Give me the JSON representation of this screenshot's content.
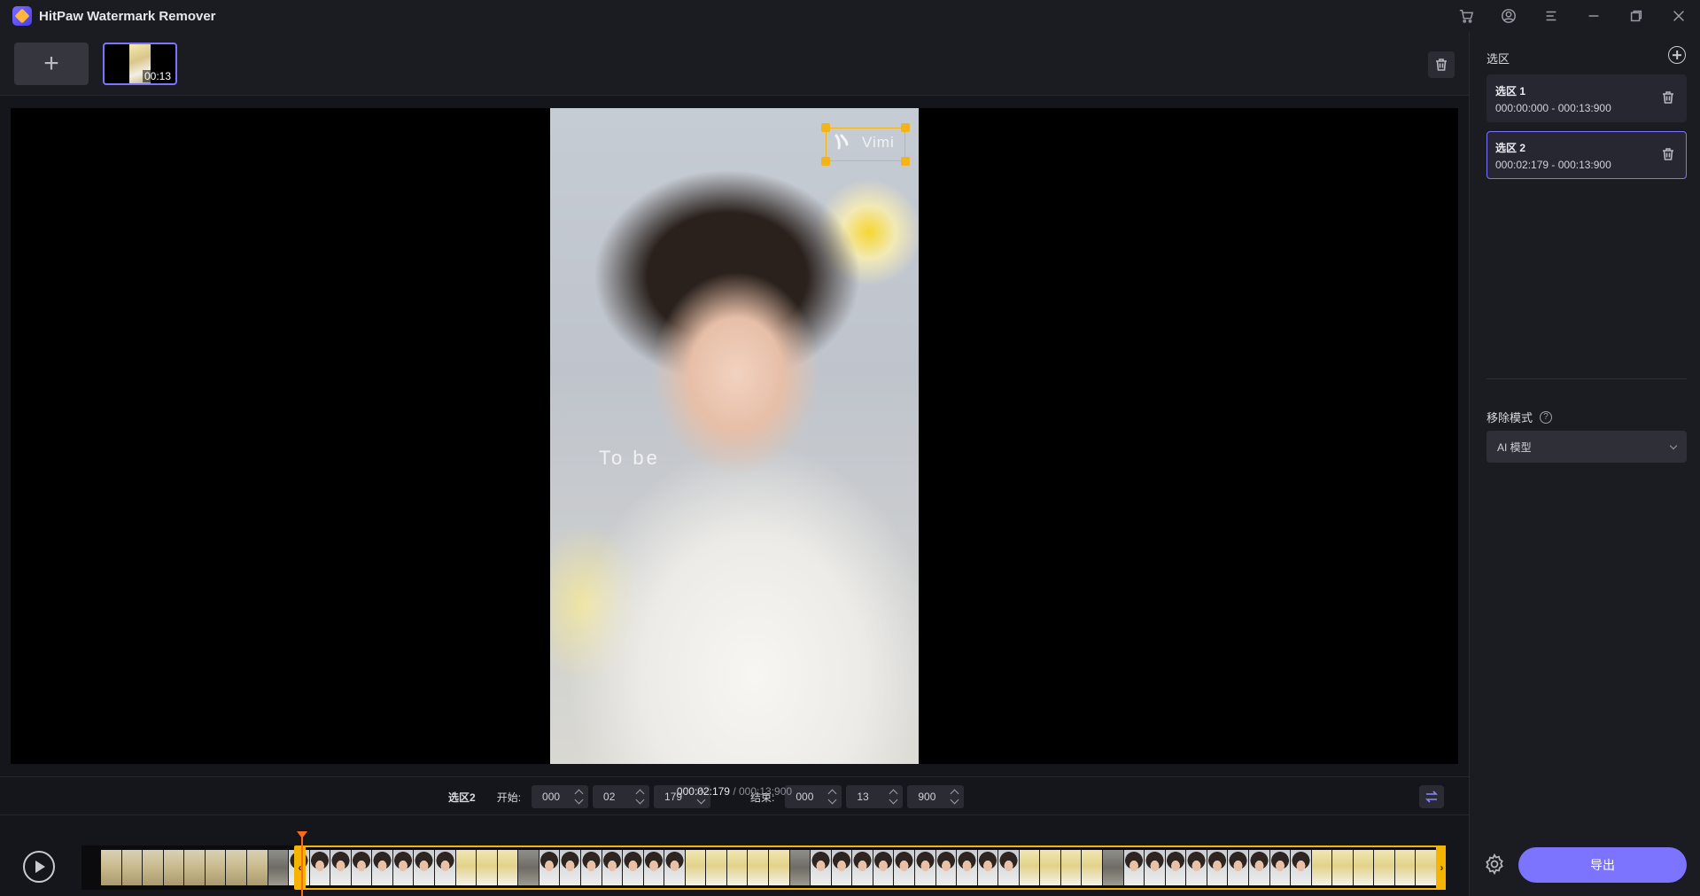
{
  "app": {
    "title": "HitPaw Watermark Remover"
  },
  "titlebar": {
    "icons": [
      "cart-icon",
      "account-icon",
      "menu-icon",
      "minimize-icon",
      "restore-icon",
      "close-icon"
    ]
  },
  "files": {
    "add_label": "+",
    "items": [
      {
        "duration": "00:13"
      }
    ]
  },
  "preview": {
    "watermarks": [
      {
        "text": "Vimi"
      },
      {
        "text": "To be"
      }
    ]
  },
  "range": {
    "selection_label": "选区2",
    "start_label": "开始:",
    "start": {
      "h": "000",
      "m": "02",
      "ms": "179"
    },
    "end_label": "结束:",
    "end": {
      "h": "000",
      "m": "13",
      "ms": "900"
    }
  },
  "timeline": {
    "current": "000:02:179",
    "separator": " / ",
    "total": "000:13:900",
    "selection_start_fraction": 0.157,
    "playhead_fraction": 0.157
  },
  "regions": {
    "title": "选区",
    "items": [
      {
        "name": "选区 1",
        "range": "000:00:000 - 000:13:900",
        "active": false
      },
      {
        "name": "选区 2",
        "range": "000:02:179 - 000:13:900",
        "active": true
      }
    ]
  },
  "mode": {
    "label": "移除模式",
    "help": "?",
    "selected": "AI 模型"
  },
  "export": {
    "label": "导出"
  },
  "colors": {
    "accent": "#7c74ff",
    "selection": "#f4b400",
    "playhead": "#ff6a1a"
  }
}
